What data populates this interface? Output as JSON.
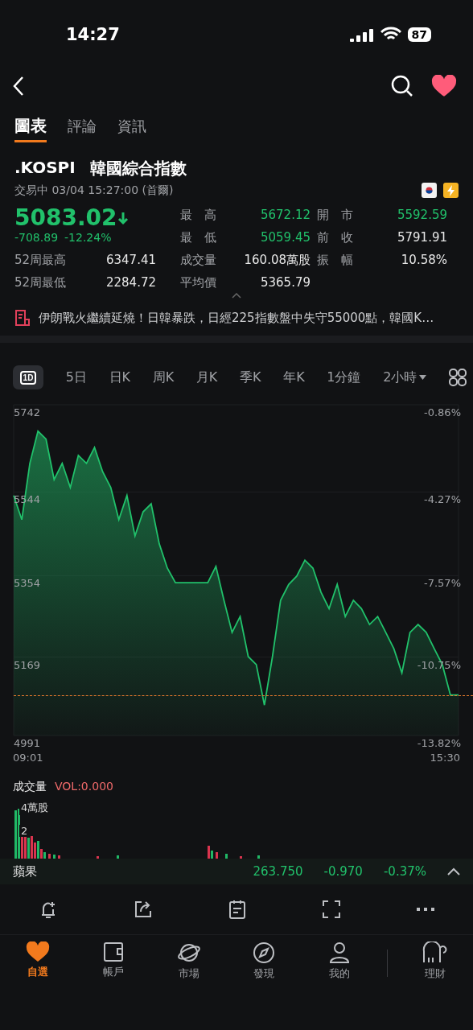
{
  "status_bar": {
    "time": "14:27",
    "battery": "87"
  },
  "tabs": [
    {
      "label": "圖表",
      "selected": true
    },
    {
      "label": "評論",
      "selected": false
    },
    {
      "label": "資訊",
      "selected": false
    }
  ],
  "quote": {
    "symbol": ".KOSPI",
    "name": "韓國綜合指數",
    "status_line": "交易中 03/04 15:27:00 (首爾)",
    "price": "5083.02",
    "change": "-708.89",
    "change_pct": "-12.24%",
    "left_stats": [
      {
        "label": "52周最高",
        "value": "6347.41"
      },
      {
        "label": "52周最低",
        "value": "2284.72"
      }
    ],
    "stats": [
      {
        "label": "最　高",
        "value": "5672.12",
        "color": "#21c16b"
      },
      {
        "label": "開　市",
        "value": "5592.59",
        "color": "#21c16b"
      },
      {
        "label": "最　低",
        "value": "5059.45",
        "color": "#21c16b"
      },
      {
        "label": "前　收",
        "value": "5791.91",
        "color": "#e8e8e8"
      },
      {
        "label": "成交量",
        "value": "160.08萬股",
        "color": "#e8e8e8"
      },
      {
        "label": "振　幅",
        "value": "10.58%",
        "color": "#e8e8e8"
      },
      {
        "label": "平均價",
        "value": "5365.79",
        "color": "#e8e8e8"
      }
    ]
  },
  "news": "伊朗戰火繼續延燒！日韓暴跌，日經225指數盤中失守55000點，韓國K…",
  "periods": [
    {
      "label": "1D",
      "selected": true,
      "kind": "icon"
    },
    {
      "label": "5日",
      "selected": false,
      "kind": "text"
    },
    {
      "label": "日K",
      "selected": false,
      "kind": "text"
    },
    {
      "label": "周K",
      "selected": false,
      "kind": "text"
    },
    {
      "label": "月K",
      "selected": false,
      "kind": "text"
    },
    {
      "label": "季K",
      "selected": false,
      "kind": "text"
    },
    {
      "label": "年K",
      "selected": false,
      "kind": "text"
    },
    {
      "label": "1分鐘",
      "selected": false,
      "kind": "text"
    },
    {
      "label": "2小時",
      "selected": false,
      "kind": "dropdown"
    }
  ],
  "chart": {
    "chart_data": {
      "type": "area",
      "values": [
        5536,
        5481,
        5609,
        5682,
        5664,
        5572,
        5609,
        5554,
        5627,
        5609,
        5645,
        5590,
        5554,
        5481,
        5536,
        5444,
        5499,
        5517,
        5426,
        5371,
        5338,
        5338,
        5338,
        5338,
        5338,
        5375,
        5298,
        5225,
        5261,
        5170,
        5152,
        5060,
        5170,
        5298,
        5334,
        5353,
        5389,
        5371,
        5316,
        5279,
        5334,
        5261,
        5298,
        5279,
        5243,
        5261,
        5225,
        5188,
        5133,
        5225,
        5243,
        5225,
        5188,
        5152,
        5083,
        5083
      ],
      "ylim": [
        4991,
        5742
      ],
      "yticks": [
        5742,
        5544,
        5354,
        5169,
        4991
      ],
      "grid": true
    },
    "percent_ticks": [
      "-0.86%",
      "-4.27%",
      "-7.57%",
      "-10.75%",
      "-13.82%"
    ],
    "time_labels": [
      "09:01",
      "15:30"
    ]
  },
  "volume": {
    "label": "成交量",
    "indicator": "VOL:0.000",
    "ticks": [
      "4萬股",
      "2"
    ]
  },
  "ticker": {
    "name": "蘋果",
    "price": "263.750",
    "change": "-0.970",
    "change_pct": "-0.37%"
  },
  "nav": [
    {
      "label": "自選",
      "selected": true,
      "kind": "heart"
    },
    {
      "label": "帳戶",
      "selected": false,
      "kind": "wallet"
    },
    {
      "label": "市場",
      "selected": false,
      "kind": "planet"
    },
    {
      "label": "發現",
      "selected": false,
      "kind": "compass"
    },
    {
      "label": "我的",
      "selected": false,
      "kind": "person"
    },
    {
      "label": "理財",
      "selected": false,
      "kind": "elephant"
    }
  ]
}
